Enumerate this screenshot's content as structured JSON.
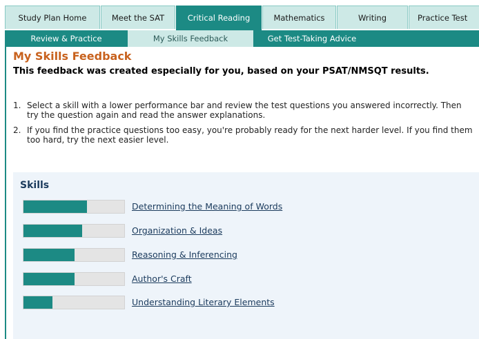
{
  "top_tabs": [
    {
      "label": "Study Plan Home",
      "active": false
    },
    {
      "label": "Meet the SAT",
      "active": false
    },
    {
      "label": "Critical Reading",
      "active": true
    },
    {
      "label": "Mathematics",
      "active": false
    },
    {
      "label": "Writing",
      "active": false
    },
    {
      "label": "Practice Test",
      "active": false
    }
  ],
  "sub_nav": [
    {
      "label": "Review & Practice",
      "active": false
    },
    {
      "label": "My Skills Feedback",
      "active": true
    },
    {
      "label": "Get Test-Taking Advice",
      "active": false
    }
  ],
  "page": {
    "title": "My Skills Feedback",
    "intro": "This feedback was created especially for you, based on your PSAT/NMSQT results.",
    "steps": [
      {
        "num": "1.",
        "text": "Select a skill with a lower performance bar and review the test questions you answered incorrectly. Then try the question again and read the answer explanations."
      },
      {
        "num": "2.",
        "text": "If you find the practice questions too easy, you're probably ready for the next harder level. If you find them too hard, try the next easier level."
      }
    ]
  },
  "skills": {
    "heading": "Skills",
    "items": [
      {
        "label": "Determining the Meaning of Words",
        "performance": 0.63
      },
      {
        "label": "Organization & Ideas",
        "performance": 0.58
      },
      {
        "label": "Reasoning & Inferencing",
        "performance": 0.51
      },
      {
        "label": "Author's Craft",
        "performance": 0.51
      },
      {
        "label": "Understanding Literary Elements",
        "performance": 0.29
      }
    ]
  },
  "colors": {
    "accent_teal": "#1c8a84",
    "tab_light": "#cde9e6",
    "title_orange": "#c8621e",
    "link_navy": "#1a3a5c",
    "panel_bg": "#eef4fa"
  }
}
